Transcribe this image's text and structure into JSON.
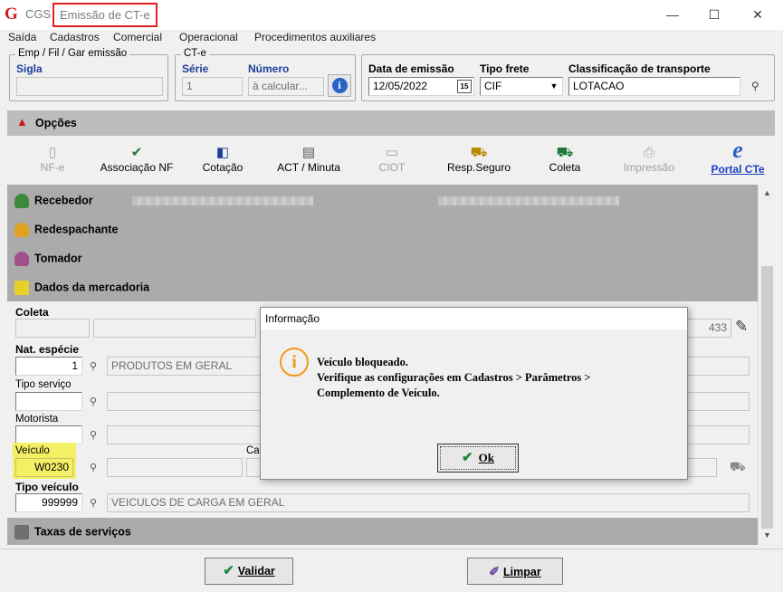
{
  "window": {
    "app_name": "CGS",
    "title": "Emissão de CT-e",
    "minimize": "—",
    "maximize": "☐",
    "close": "✕"
  },
  "menu": [
    "Saída",
    "Cadastros",
    "Comercial",
    "Operacional",
    "Procedimentos auxiliares"
  ],
  "emp_group": {
    "legend": "Emp / Fil / Gar emissão",
    "sigla_label": "Sigla"
  },
  "cte_group": {
    "legend": "CT-e",
    "serie_label": "Série",
    "serie_value": "1",
    "numero_label": "Número",
    "numero_value": "à calcular..."
  },
  "emissao": {
    "data_label": "Data de emissão",
    "data_value": "12/05/2022",
    "calendar_badge": "15",
    "tipo_frete_label": "Tipo frete",
    "tipo_frete_value": "CIF",
    "classificacao_label": "Classificação de transporte",
    "classificacao_value": "LOTACAO"
  },
  "opcoes": {
    "label": "Opções"
  },
  "toolbar": [
    {
      "name": "nfe",
      "label": "NF-e",
      "enabled": false
    },
    {
      "name": "associacao-nf",
      "label": "Associação NF",
      "enabled": true
    },
    {
      "name": "cotacao",
      "label": "Cotação",
      "enabled": true
    },
    {
      "name": "act-minuta",
      "label": "ACT / Minuta",
      "enabled": true
    },
    {
      "name": "ciot",
      "label": "CIOT",
      "enabled": false
    },
    {
      "name": "resp-seguro",
      "label": "Resp.Seguro",
      "enabled": true
    },
    {
      "name": "coleta",
      "label": "Coleta",
      "enabled": true
    },
    {
      "name": "impressao",
      "label": "Impressão",
      "enabled": false
    }
  ],
  "portal": {
    "label": "Portal CTe",
    "badge_text": "e"
  },
  "sections": {
    "recebedor": "Recebedor",
    "redespachante": "Redespachante",
    "tomador": "Tomador",
    "dados_mercadoria": "Dados da mercadoria",
    "taxas": "Taxas de serviços"
  },
  "fields": {
    "coleta_label": "Coleta",
    "coleta_trailing_value": "433",
    "nat_especie_label": "Nat. espécie",
    "nat_especie_code": "1",
    "nat_especie_desc": "PRODUTOS EM GERAL",
    "tipo_servico_label": "Tipo serviço",
    "motorista_label": "Motorista",
    "veiculo_label": "Veículo",
    "veiculo_value": "W0230",
    "carreta_label_partial": "Car",
    "tipo_veiculo_label": "Tipo veículo",
    "tipo_veiculo_code": "999999",
    "tipo_veiculo_desc": "VEICULOS DE CARGA EM GERAL"
  },
  "dialog": {
    "title": "Informação",
    "icon_glyph": "i",
    "line1": "Veículo bloqueado.",
    "line2": "Verifique as configurações em Cadastros > Parâmetros >",
    "line3": "Complemento de Veículo.",
    "ok_label": "Ok"
  },
  "footer": {
    "validar_label": "Validar",
    "limpar_label": "Limpar"
  },
  "colors": {
    "accent_blue": "#1c3f9a",
    "highlight_yellow": "#f4f066",
    "info_orange": "#f09a1a",
    "title_red": "#e02020",
    "panel_gray": "#ababab"
  }
}
